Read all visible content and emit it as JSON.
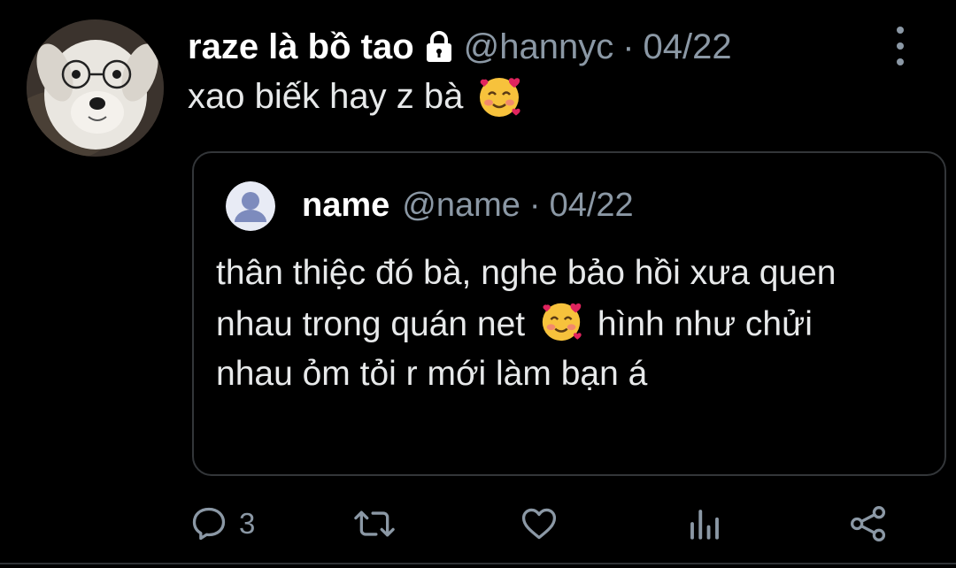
{
  "tweet": {
    "display_name": "raze là bồ tao",
    "handle": "@hannyc",
    "separator": "·",
    "date": "04/22",
    "text": "xao biếk hay z bà",
    "emoji": "smiling-face-with-hearts"
  },
  "quoted": {
    "display_name": "name",
    "handle": "@name",
    "separator": "·",
    "date": "04/22",
    "text_part1": "thân thiệc đó bà, nghe bảo hồi xưa quen nhau trong quán net",
    "text_part2": "hình như chửi nhau ỏm tỏi r mới làm bạn á",
    "emoji": "smiling-face-with-hearts"
  },
  "actions": {
    "reply_count": "3",
    "icons": [
      "reply-icon",
      "retweet-icon",
      "like-icon",
      "analytics-icon",
      "share-icon"
    ]
  },
  "colors": {
    "background": "#000000",
    "text": "#e7e9ea",
    "secondary": "#8b98a5",
    "border": "#333639"
  }
}
